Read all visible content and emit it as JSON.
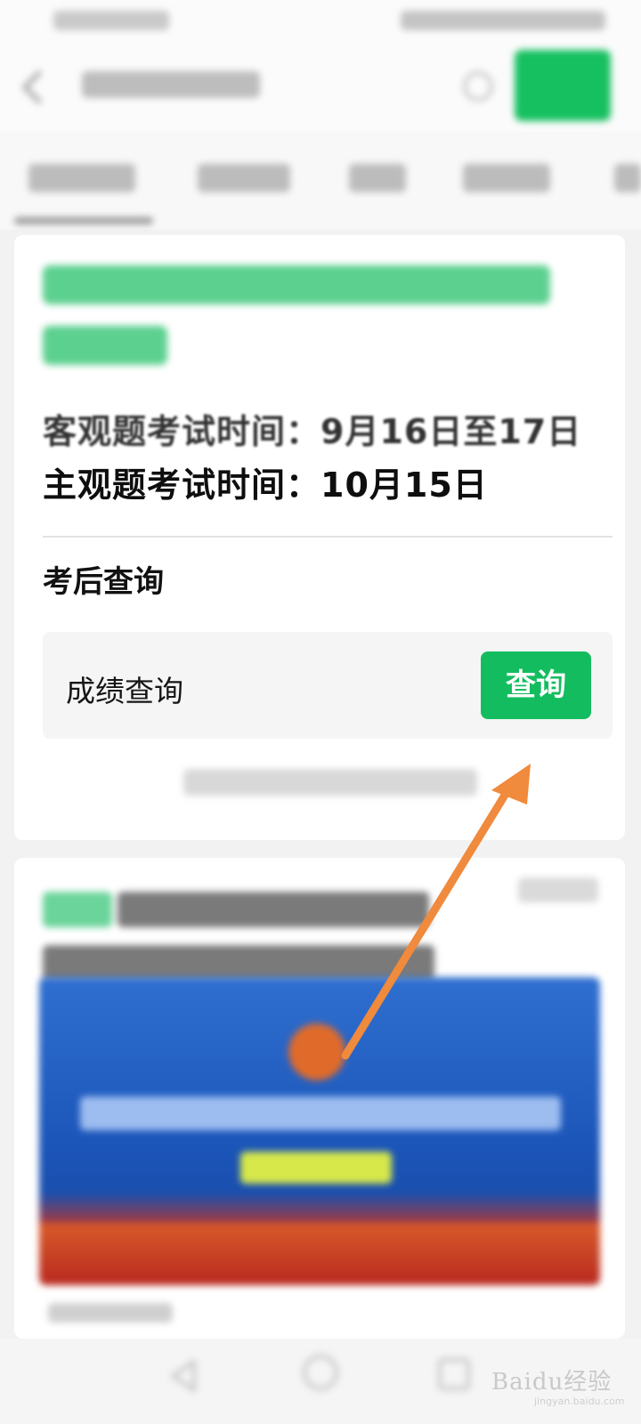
{
  "search": {
    "button_label": ""
  },
  "exam": {
    "objective_time": "客观题考试时间：9月16日至17日",
    "subjective_time": "主观题考试时间：10月15日"
  },
  "post_exam": {
    "section_title": "考后查询",
    "query_label": "成绩查询",
    "query_button": "查询"
  },
  "annotation": {
    "arrow_color": "#f08a3c"
  },
  "watermark": {
    "text": "Baidu经验",
    "sub": "jingyan.baidu.com"
  },
  "colors": {
    "accent": "#13bd5f",
    "background": "#f2f2f2"
  },
  "icons": [
    "back-icon",
    "clear-icon",
    "nav-back-icon",
    "nav-home-icon",
    "nav-recent-icon"
  ]
}
